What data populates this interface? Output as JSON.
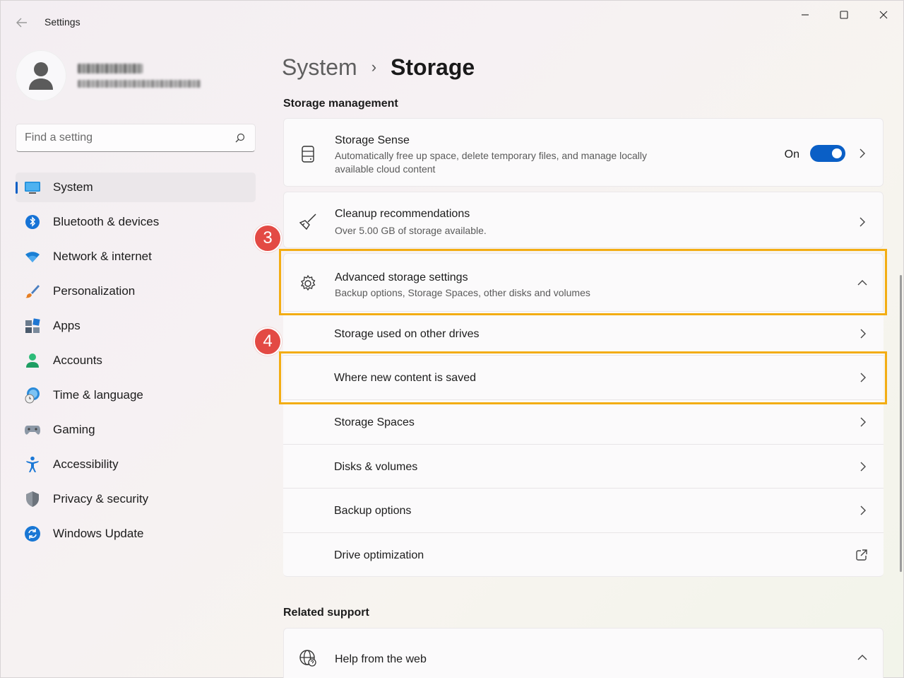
{
  "window": {
    "app_title": "Settings",
    "back_icon": "back-arrow-icon",
    "minimize_icon": "minimize-icon",
    "maximize_icon": "maximize-icon",
    "close_icon": "close-icon"
  },
  "profile": {
    "avatar_icon": "user-avatar-icon",
    "name_blurred": true,
    "email_blurred": true
  },
  "search": {
    "placeholder": "Find a setting",
    "value": "",
    "icon": "search-icon"
  },
  "sidebar": {
    "items": [
      {
        "label": "System",
        "icon": "system-monitor-icon",
        "selected": true
      },
      {
        "label": "Bluetooth & devices",
        "icon": "bluetooth-icon",
        "selected": false
      },
      {
        "label": "Network & internet",
        "icon": "wifi-icon",
        "selected": false
      },
      {
        "label": "Personalization",
        "icon": "paintbrush-icon",
        "selected": false
      },
      {
        "label": "Apps",
        "icon": "apps-icon",
        "selected": false
      },
      {
        "label": "Accounts",
        "icon": "account-icon",
        "selected": false
      },
      {
        "label": "Time & language",
        "icon": "globe-clock-icon",
        "selected": false
      },
      {
        "label": "Gaming",
        "icon": "gamepad-icon",
        "selected": false
      },
      {
        "label": "Accessibility",
        "icon": "accessibility-icon",
        "selected": false
      },
      {
        "label": "Privacy & security",
        "icon": "shield-icon",
        "selected": false
      },
      {
        "label": "Windows Update",
        "icon": "update-icon",
        "selected": false
      }
    ]
  },
  "breadcrumb": {
    "parent": "System",
    "separator": "›",
    "current": "Storage"
  },
  "storage_management": {
    "title": "Storage management",
    "storage_sense": {
      "title": "Storage Sense",
      "subtitle": "Automatically free up space, delete temporary files, and manage locally available cloud content",
      "toggle_label": "On",
      "toggle_on": true,
      "icon": "storage-drive-icon"
    },
    "cleanup": {
      "title": "Cleanup recommendations",
      "subtitle": "Over 5.00 GB of storage available.",
      "icon": "broom-icon"
    },
    "advanced": {
      "title": "Advanced storage settings",
      "subtitle": "Backup options, Storage Spaces, other disks and volumes",
      "icon": "gear-icon",
      "expanded": true
    },
    "advanced_items": [
      {
        "label": "Storage used on other drives",
        "action": "chevron"
      },
      {
        "label": "Where new content is saved",
        "action": "chevron"
      },
      {
        "label": "Storage Spaces",
        "action": "chevron"
      },
      {
        "label": "Disks & volumes",
        "action": "chevron"
      },
      {
        "label": "Backup options",
        "action": "chevron"
      },
      {
        "label": "Drive optimization",
        "action": "external-link"
      }
    ]
  },
  "related_support": {
    "title": "Related support",
    "help": {
      "title": "Help from the web",
      "icon": "web-help-icon"
    }
  },
  "annotations": {
    "step3": "3",
    "step4": "4",
    "highlight_color": "#f3ad13",
    "badge_color": "#e34a44"
  },
  "colors": {
    "accent": "#0a5fc6"
  }
}
